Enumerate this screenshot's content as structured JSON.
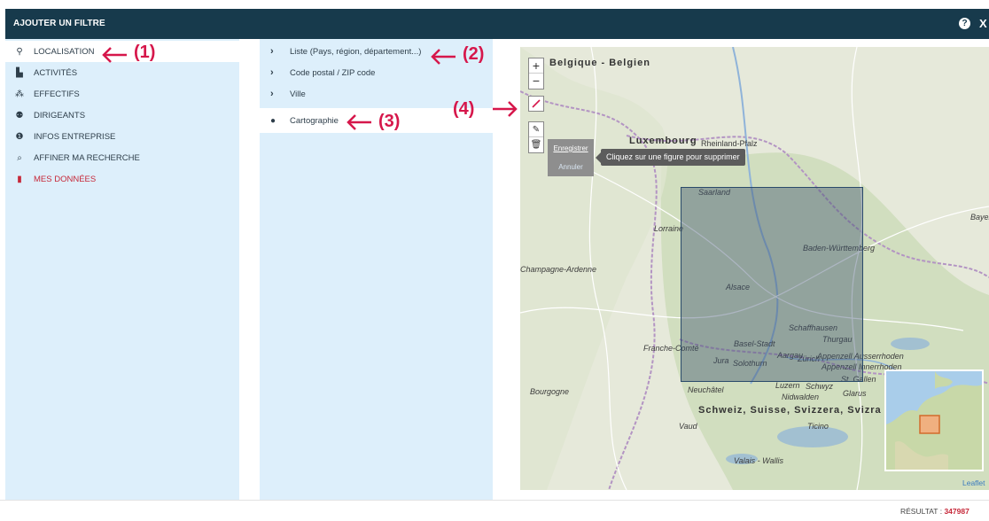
{
  "header": {
    "title": "AJOUTER UN FILTRE",
    "help": "?",
    "close": "X"
  },
  "left_menu": [
    {
      "label": "LOCALISATION",
      "icon": "map-pin-icon",
      "glyph": "⚲",
      "active": true
    },
    {
      "label": "ACTIVITÉS",
      "icon": "industry-icon",
      "glyph": "▙"
    },
    {
      "label": "EFFECTIFS",
      "icon": "group-icon",
      "glyph": "⁂"
    },
    {
      "label": "DIRIGEANTS",
      "icon": "users-icon",
      "glyph": "⚉"
    },
    {
      "label": "INFOS ENTREPRISE",
      "icon": "info-icon",
      "glyph": "❶"
    },
    {
      "label": "AFFINER MA RECHERCHE",
      "icon": "search-icon",
      "glyph": "⌕"
    },
    {
      "label": "MES DONNÉES",
      "icon": "file-icon",
      "glyph": "▮",
      "highlight": true
    }
  ],
  "sub_menu": [
    {
      "label": "Liste (Pays, région, département...)"
    },
    {
      "label": "Code postal / ZIP code"
    },
    {
      "label": "Ville"
    }
  ],
  "cartography": {
    "label": "Cartographie",
    "icon": "globe-icon"
  },
  "map": {
    "zoom_in": "+",
    "zoom_out": "−",
    "save": "Enregistrer",
    "cancel": "Annuler",
    "tooltip": "Cliquez sur une figure pour supprimer",
    "attribution": "Leaflet",
    "labels": {
      "belgique": "Belgique - Belgien",
      "luxembourg": "Luxembourg",
      "rheinland": "Rheinland-Pfalz",
      "saarland": "Saarland",
      "lorraine": "Lorraine",
      "bayern": "Bayern",
      "baden": "Baden-Württemberg",
      "champagne": "Champagne-Ardenne",
      "alsace": "Alsace",
      "schaffhausen": "Schaffhausen",
      "thurgau": "Thurgau",
      "basel": "Basel-Stadt",
      "aargau": "Aargau",
      "zurich": "Zürich",
      "appenzell1": "Appenzell Ausserrhoden",
      "appenzell2": "Appenzell Innerrhoden",
      "franche": "Franche-Comté",
      "jura": "Jura",
      "solothurn": "Solothurn",
      "stgallen": "St. Gallen",
      "bourgogne": "Bourgogne",
      "neuchatel": "Neuchâtel",
      "lucerne": "Luzern",
      "schwyz": "Schwyz",
      "glarus": "Glarus",
      "nidwalden": "Nidwalden",
      "schweiz": "Schweiz, Suisse, Svizzera, Svizra",
      "vaud": "Vaud",
      "ticino": "Ticino",
      "valais": "Valais - Wallis"
    }
  },
  "annotations": {
    "a1": "(1)",
    "a2": "(2)",
    "a3": "(3)",
    "a4": "(4)"
  },
  "annotation_color": "#d6174b",
  "footer": {
    "label": "RÉSULTAT :",
    "value": "347987"
  }
}
